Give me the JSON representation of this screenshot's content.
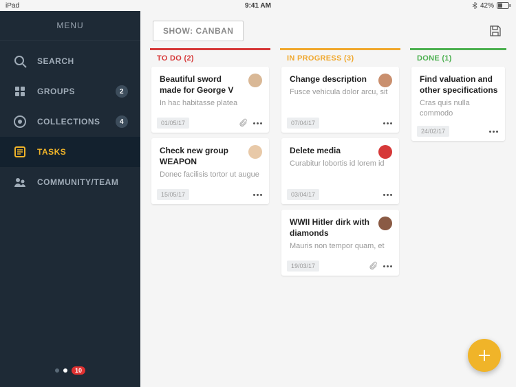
{
  "statusbar": {
    "device": "iPad",
    "time": "9:41 AM",
    "battery": "42%"
  },
  "sidebar": {
    "header": "MENU",
    "items": [
      {
        "label": "SEARCH",
        "icon": "search",
        "badge": ""
      },
      {
        "label": "GROUPS",
        "icon": "groups",
        "badge": "2"
      },
      {
        "label": "COLLECTIONS",
        "icon": "collections",
        "badge": "4"
      },
      {
        "label": "TASKS",
        "icon": "tasks",
        "badge": "",
        "active": true
      },
      {
        "label": "COMMUNITY/TEAM",
        "icon": "community",
        "badge": ""
      }
    ],
    "pager_badge": "10"
  },
  "topbar": {
    "show_label": "SHOW: CANBAN"
  },
  "columns": [
    {
      "key": "todo",
      "header": "TO DO (2)",
      "cards": [
        {
          "title": "Beautiful sword made for George V",
          "sub": "In hac habitasse platea",
          "date": "01/05/17",
          "attach": true,
          "avatar": "#d9b896"
        },
        {
          "title": "Check new group WEAPON",
          "sub": "Donec facilisis tortor ut augue",
          "date": "15/05/17",
          "attach": false,
          "avatar": "#e8c9a8"
        }
      ]
    },
    {
      "key": "progress",
      "header": "IN PROGRESS (3)",
      "cards": [
        {
          "title": "Change description",
          "sub": "Fusce vehicula dolor arcu, sit",
          "date": "07/04/17",
          "attach": false,
          "avatar": "#c98f6e"
        },
        {
          "title": "Delete media",
          "sub": "Curabitur lobortis id lorem id",
          "date": "03/04/17",
          "attach": false,
          "avatar": "#d63939"
        },
        {
          "title": "WWII Hitler dirk with diamonds",
          "sub": "Mauris non tempor quam, et",
          "date": "19/03/17",
          "attach": true,
          "avatar": "#8a5a44"
        }
      ]
    },
    {
      "key": "done",
      "header": "DONE (1)",
      "cards": [
        {
          "title": "Find valuation and other specifications",
          "sub": "Cras quis nulla commodo",
          "date": "24/02/17",
          "attach": false,
          "avatar": ""
        }
      ]
    }
  ]
}
